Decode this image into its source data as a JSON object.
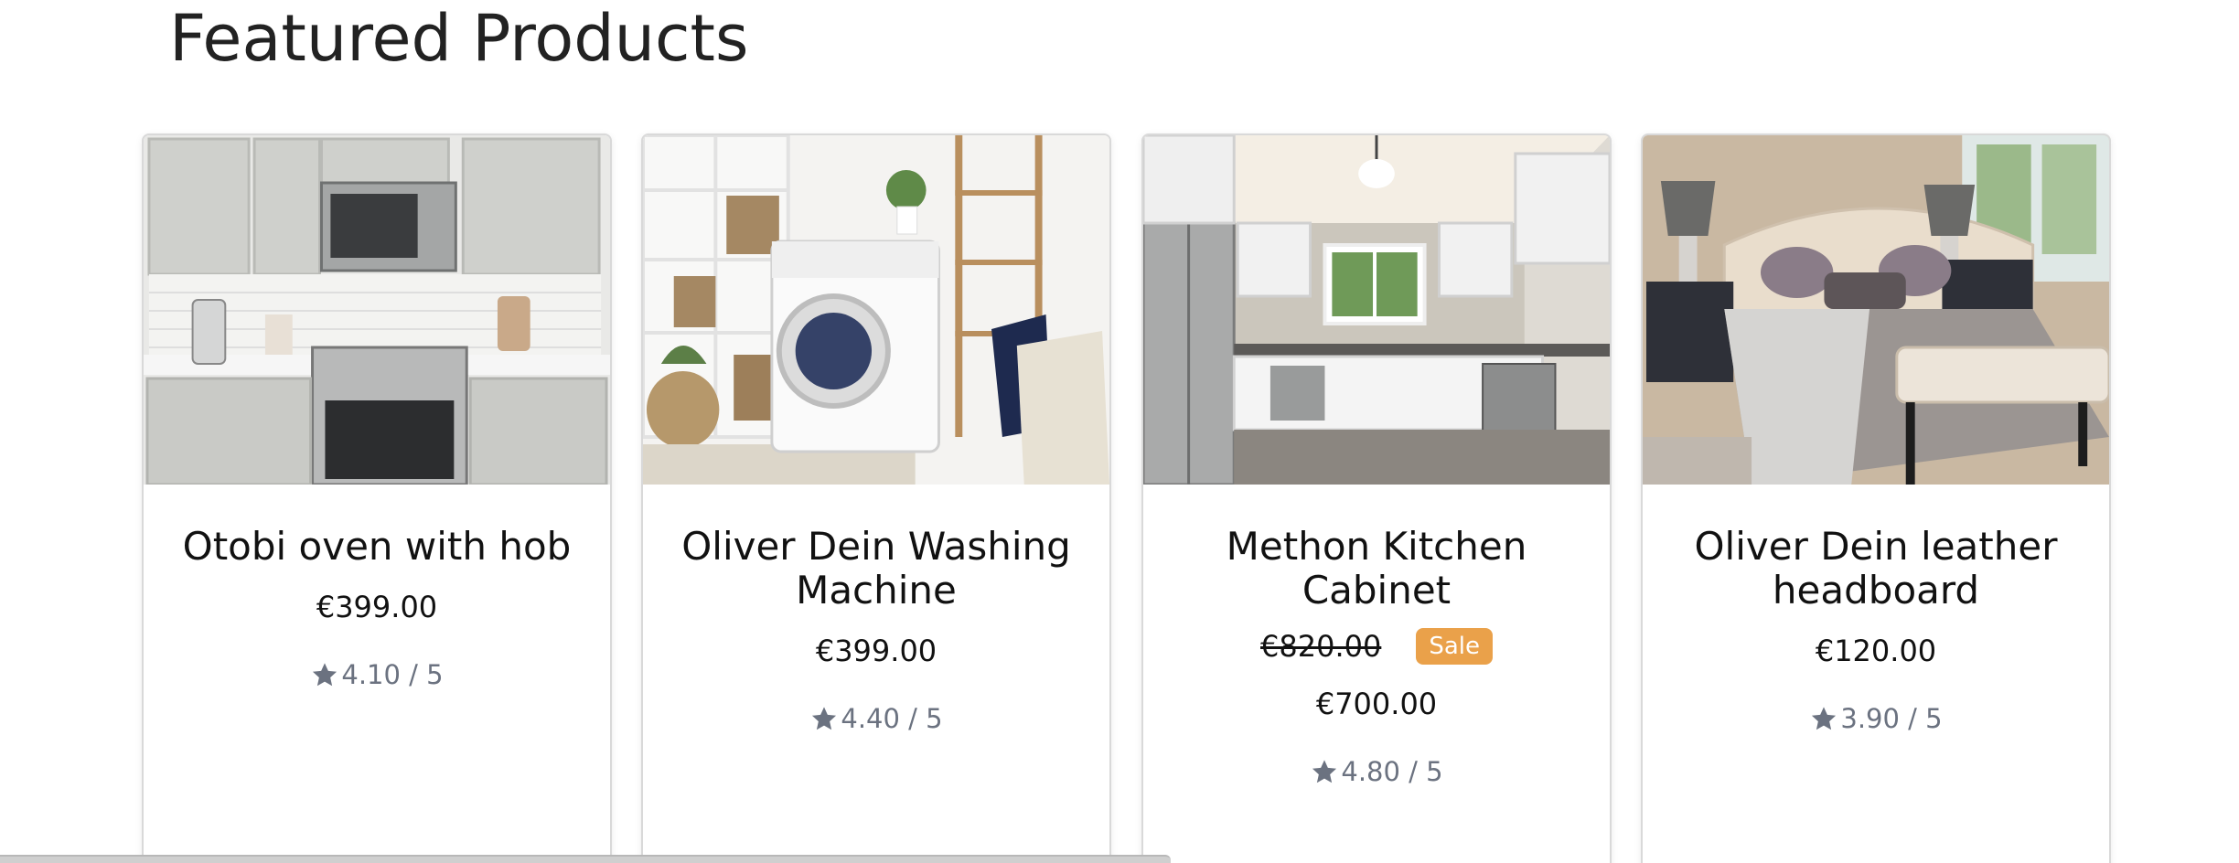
{
  "section": {
    "title": "Featured Products"
  },
  "products": [
    {
      "name": "Otobi oven with hob",
      "price": "€399.00",
      "old_price": "",
      "badge": "",
      "rating": "4.10 / 5",
      "image": "kitchen-oven-photo"
    },
    {
      "name": "Oliver Dein Washing Machine",
      "price": "€399.00",
      "old_price": "",
      "badge": "",
      "rating": "4.40 / 5",
      "image": "laundry-washer-photo"
    },
    {
      "name": "Methon Kitchen Cabinet",
      "price": "€700.00",
      "old_price": "€820.00",
      "badge": "Sale",
      "rating": "4.80 / 5",
      "image": "kitchen-cabinet-photo"
    },
    {
      "name": "Oliver Dein leather headboard",
      "price": "€120.00",
      "old_price": "",
      "badge": "",
      "rating": "3.90 / 5",
      "image": "bedroom-bed-photo"
    }
  ],
  "colors": {
    "sale_badge": "#eaa14a",
    "rating_text": "#6b7280",
    "star": "#6b7280"
  },
  "icons": {
    "rating": "star-icon"
  }
}
